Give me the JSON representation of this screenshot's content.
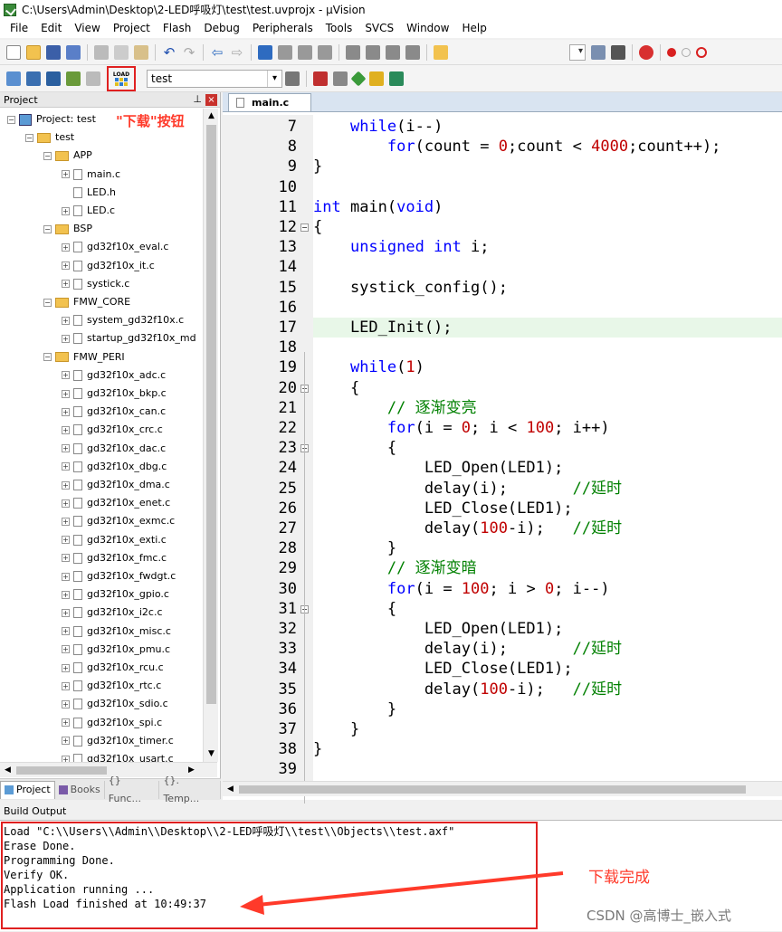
{
  "window": {
    "title": "C:\\Users\\Admin\\Desktop\\2-LED呼吸灯\\test\\test.uvprojx - µVision"
  },
  "menu": [
    "File",
    "Edit",
    "View",
    "Project",
    "Flash",
    "Debug",
    "Peripherals",
    "Tools",
    "SVCS",
    "Window",
    "Help"
  ],
  "toolbar": {
    "load_label": "LOAD",
    "target": "test"
  },
  "project_pane": {
    "title": "Project",
    "root": "Project: test",
    "target": "test",
    "groups": [
      {
        "name": "APP",
        "files": [
          "main.c",
          "LED.h",
          "LED.c"
        ]
      },
      {
        "name": "BSP",
        "files": [
          "gd32f10x_eval.c",
          "gd32f10x_it.c",
          "systick.c"
        ]
      },
      {
        "name": "FMW_CORE",
        "files": [
          "system_gd32f10x.c",
          "startup_gd32f10x_md"
        ]
      },
      {
        "name": "FMW_PERI",
        "files": [
          "gd32f10x_adc.c",
          "gd32f10x_bkp.c",
          "gd32f10x_can.c",
          "gd32f10x_crc.c",
          "gd32f10x_dac.c",
          "gd32f10x_dbg.c",
          "gd32f10x_dma.c",
          "gd32f10x_enet.c",
          "gd32f10x_exmc.c",
          "gd32f10x_exti.c",
          "gd32f10x_fmc.c",
          "gd32f10x_fwdgt.c",
          "gd32f10x_gpio.c",
          "gd32f10x_i2c.c",
          "gd32f10x_misc.c",
          "gd32f10x_pmu.c",
          "gd32f10x_rcu.c",
          "gd32f10x_rtc.c",
          "gd32f10x_sdio.c",
          "gd32f10x_spi.c",
          "gd32f10x_timer.c",
          "gd32f10x_usart.c"
        ]
      }
    ],
    "tabs": [
      "Project",
      "Books",
      "{} Func...",
      "{}. Temp..."
    ]
  },
  "annotations": {
    "download_button": "\"下载\"按钮",
    "download_done": "下载完成",
    "watermark": "CSDN @高博士_嵌入式"
  },
  "editor": {
    "tab": "main.c",
    "lines": [
      {
        "n": "7",
        "code": "    while(i--)"
      },
      {
        "n": "8",
        "code": "        for(count = 0;count < 4000;count++);"
      },
      {
        "n": "9",
        "code": "}"
      },
      {
        "n": "10",
        "code": ""
      },
      {
        "n": "11",
        "code": "int main(void)"
      },
      {
        "n": "12",
        "code": "{"
      },
      {
        "n": "13",
        "code": "    unsigned int i;"
      },
      {
        "n": "14",
        "code": ""
      },
      {
        "n": "15",
        "code": "    systick_config();"
      },
      {
        "n": "16",
        "code": ""
      },
      {
        "n": "17",
        "code": "    LED_Init();"
      },
      {
        "n": "18",
        "code": ""
      },
      {
        "n": "19",
        "code": "    while(1)"
      },
      {
        "n": "20",
        "code": "    {"
      },
      {
        "n": "21",
        "code": "        // 逐渐变亮"
      },
      {
        "n": "22",
        "code": "        for(i = 0; i < 100; i++)"
      },
      {
        "n": "23",
        "code": "        {"
      },
      {
        "n": "24",
        "code": "            LED_Open(LED1);"
      },
      {
        "n": "25",
        "code": "            delay(i);       //延时"
      },
      {
        "n": "26",
        "code": "            LED_Close(LED1);"
      },
      {
        "n": "27",
        "code": "            delay(100-i);   //延时"
      },
      {
        "n": "28",
        "code": "        }"
      },
      {
        "n": "29",
        "code": "        // 逐渐变暗"
      },
      {
        "n": "30",
        "code": "        for(i = 100; i > 0; i--)"
      },
      {
        "n": "31",
        "code": "        {"
      },
      {
        "n": "32",
        "code": "            LED_Open(LED1);"
      },
      {
        "n": "33",
        "code": "            delay(i);       //延时"
      },
      {
        "n": "34",
        "code": "            LED_Close(LED1);"
      },
      {
        "n": "35",
        "code": "            delay(100-i);   //延时"
      },
      {
        "n": "36",
        "code": "        }"
      },
      {
        "n": "37",
        "code": "    }"
      },
      {
        "n": "38",
        "code": "}"
      },
      {
        "n": "39",
        "code": ""
      }
    ]
  },
  "build_output": {
    "title": "Build Output",
    "lines": [
      "Load \"C:\\\\Users\\\\Admin\\\\Desktop\\\\2-LED呼吸灯\\\\test\\\\Objects\\\\test.axf\"",
      "Erase Done.",
      "Programming Done.",
      "Verify OK.",
      "Application running ...",
      "Flash Load finished at 10:49:37"
    ]
  }
}
